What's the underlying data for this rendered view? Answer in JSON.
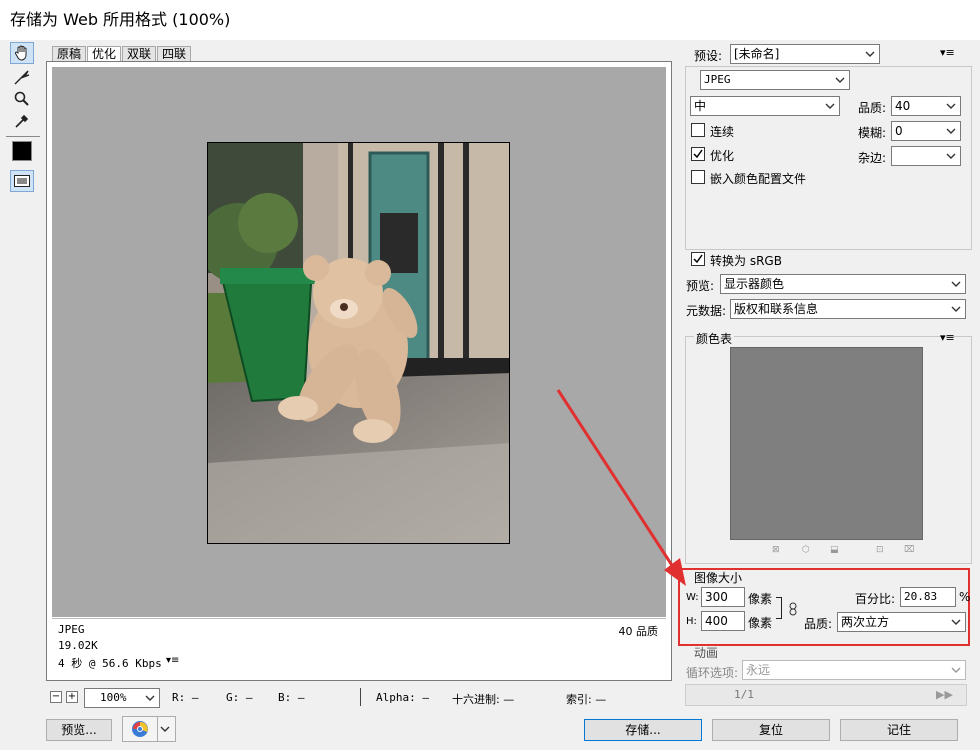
{
  "window": {
    "title": "存储为 Web 所用格式 (100%)"
  },
  "tabs": [
    "原稿",
    "优化",
    "双联",
    "四联"
  ],
  "tools": [
    "hand-tool",
    "slice-select-tool",
    "zoom-tool",
    "eyedropper-tool",
    "eyedropper-color",
    "toggle-slices"
  ],
  "image_info": {
    "format": "JPEG",
    "size": "19.02K",
    "time": "4 秒 @ 56.6 Kbps",
    "quality": "40 品质"
  },
  "statusbar": {
    "zoom": "100%",
    "r": "R: —",
    "g": "G: —",
    "b": "B: —",
    "alpha": "Alpha: —",
    "hex": "十六进制: —",
    "index": "索引: —"
  },
  "preset": {
    "label": "预设:",
    "value": "[未命名]"
  },
  "settings": {
    "format": "JPEG",
    "quality_level": "中",
    "quality_label": "品质:",
    "quality_value": "40",
    "progressive_label": "连续",
    "progressive_checked": false,
    "optimized_label": "优化",
    "optimized_checked": true,
    "embed_profile_label": "嵌入颜色配置文件",
    "embed_profile_checked": false,
    "blur_label": "模糊:",
    "blur_value": "0",
    "matte_label": "杂边:",
    "matte_value": ""
  },
  "color": {
    "convert_srgb_label": "转换为 sRGB",
    "convert_srgb_checked": true,
    "preview_label": "预览:",
    "preview_value": "显示器颜色",
    "metadata_label": "元数据:",
    "metadata_value": "版权和联系信息"
  },
  "color_table": {
    "title": "颜色表"
  },
  "image_size": {
    "title": "图像大小",
    "w_label": "W:",
    "width": "300",
    "h_label": "H:",
    "height": "400",
    "unit": "像素",
    "percent_label": "百分比:",
    "percent": "20.83",
    "percent_unit": "%",
    "quality_label": "品质:",
    "quality_value": "两次立方"
  },
  "animation": {
    "title": "动画",
    "loop_label": "循环选项:",
    "loop_value": "永远",
    "frame": "1/1"
  },
  "buttons": {
    "preview": "预览...",
    "save": "存储...",
    "reset": "复位",
    "remember": "记住"
  },
  "colors": {
    "accent": "#0078d7",
    "highlight": "#e03030",
    "canvas": "#a8a8a8"
  }
}
